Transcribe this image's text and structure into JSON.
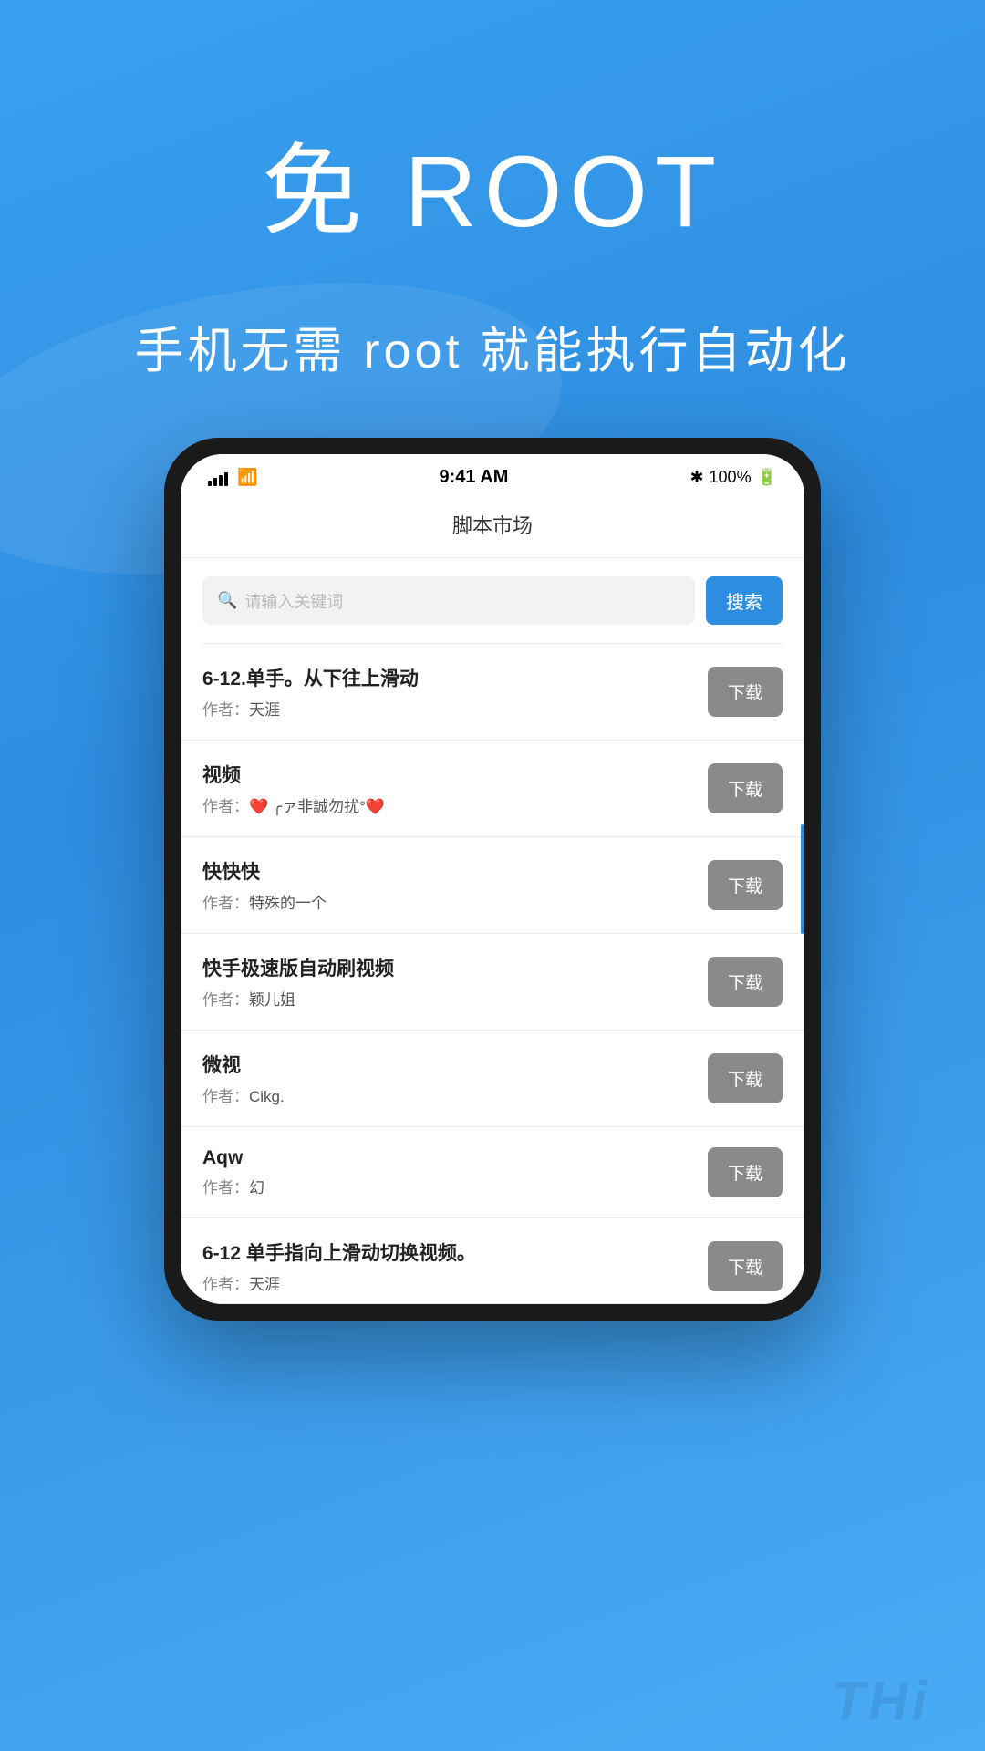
{
  "background": {
    "gradient_start": "#3aa0f0",
    "gradient_end": "#4aabf5"
  },
  "hero": {
    "title": "免 ROOT",
    "subtitle": "手机无需 root 就能执行自动化"
  },
  "phone": {
    "status_bar": {
      "time": "9:41 AM",
      "battery": "100%",
      "bluetooth": "✱"
    },
    "header": {
      "title": "脚本市场"
    },
    "search": {
      "placeholder": "请输入关键词",
      "button_label": "搜索"
    },
    "scripts": [
      {
        "name": "6-12.单手。从下往上滑动",
        "author_prefix": "作者：",
        "author": "天涯",
        "download_label": "下载"
      },
      {
        "name": "视频",
        "author_prefix": "作者：",
        "author": "❤️ ╭ァ非誠勿扰°❤️",
        "download_label": "下载"
      },
      {
        "name": "快快快",
        "author_prefix": "作者：",
        "author": "特殊的一个",
        "download_label": "下载"
      },
      {
        "name": "快手极速版自动刷视频",
        "author_prefix": "作者：",
        "author": "颖儿姐",
        "download_label": "下载"
      },
      {
        "name": "微视",
        "author_prefix": "作者：",
        "author": "Cikg.",
        "download_label": "下载"
      },
      {
        "name": "Aqw",
        "author_prefix": "作者：",
        "author": "幻",
        "download_label": "下载"
      },
      {
        "name": "6-12 单手指向上滑动切换视频。",
        "author_prefix": "作者：",
        "author": "天涯",
        "download_label": "下载",
        "partial": true
      }
    ]
  },
  "bottom_watermark": "THi"
}
